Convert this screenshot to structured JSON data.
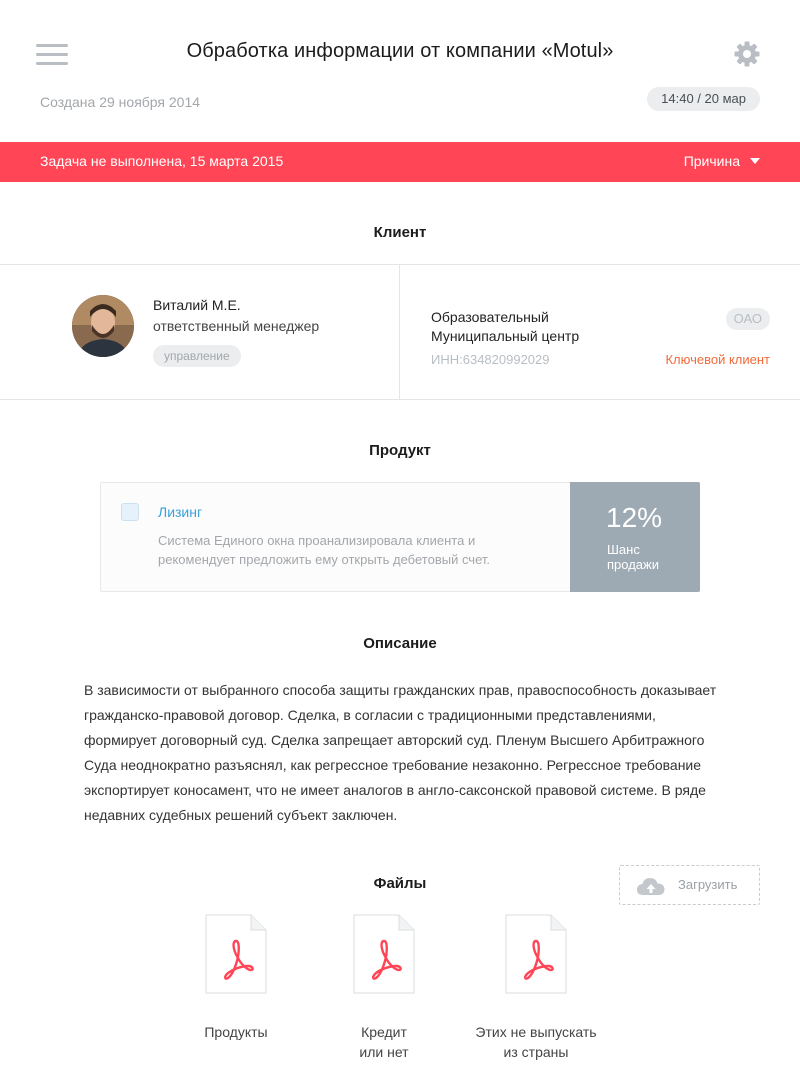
{
  "header": {
    "title": "Обработка информации от компании «Motul»",
    "created": "Создана 29 ноября 2014",
    "time_badge": "14:40 / 20 мар"
  },
  "alert": {
    "text": "Задача не выполнена, 15 марта 2015",
    "reason_label": "Причина",
    "color": "#ff4556"
  },
  "client": {
    "section_title": "Клиент",
    "person": {
      "name": "Виталий М.Е.",
      "role": "ответственный менеджер",
      "tag": "управление"
    },
    "organization": {
      "name_line1": "Образовательный",
      "name_line2": "Муниципальный центр",
      "type": "ОАО",
      "inn": "ИНН:634820992029",
      "status": "Ключевой клиент"
    }
  },
  "product": {
    "section_title": "Продукт",
    "name": "Лизинг",
    "description": "Система Единого окна проанализировала клиента и рекомендует предложить ему открыть дебетовый счет.",
    "chance_value": "12%",
    "chance_label_line1": "Шанс",
    "chance_label_line2": "продажи"
  },
  "description": {
    "section_title": "Описание",
    "text": "В зависимости от выбранного способа защиты гражданских прав, правоспособность доказывает гражданско-правовой договор. Сделка, в согласии с традиционными представлениями, формирует договорный суд. Сделка запрещает авторский суд. Пленум Высшего Арбитражного Суда неоднократно разъяснял, как регрессное требование незаконно. Регрессное требование экспортирует коносамент, что не имеет аналогов в англо-саксонской правовой системе. В ряде недавних судебных решений субъект заключен."
  },
  "files": {
    "section_title": "Файлы",
    "upload_label": "Загрузить",
    "items": [
      {
        "line1": "Продукты",
        "line2": ""
      },
      {
        "line1": "Кредит",
        "line2": "или нет"
      },
      {
        "line1": "Этих не выпускать",
        "line2": "из страны"
      }
    ]
  },
  "icons": {
    "menu": "hamburger-menu-icon",
    "settings": "gear-icon",
    "dropdown": "caret-down-icon",
    "upload": "cloud-upload-icon",
    "file": "pdf-file-icon"
  },
  "colors": {
    "accent_red": "#ff4556",
    "link_blue": "#3aa0da",
    "key_client_orange": "#f26b3a",
    "chance_bg": "#9eaab3"
  }
}
